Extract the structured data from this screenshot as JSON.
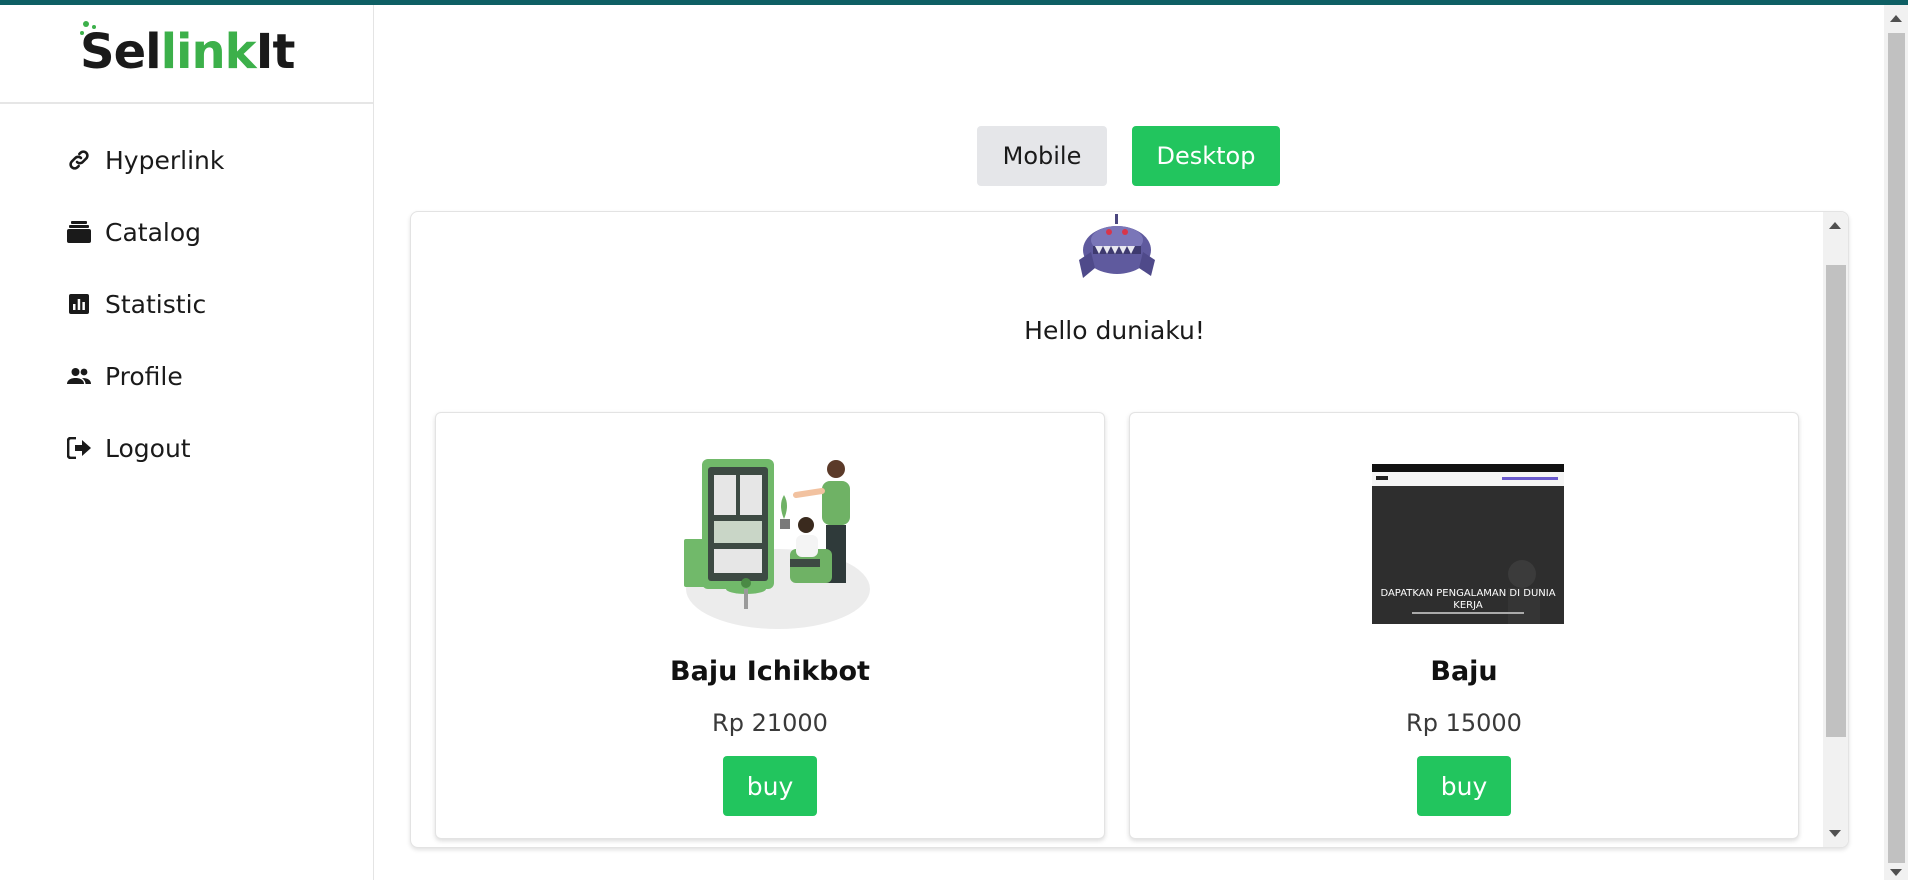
{
  "brand": {
    "logo_part1": "Sel",
    "logo_part2": "link",
    "logo_part3": "It",
    "green": "#3cb04a",
    "dark": "#1a1a1a"
  },
  "sidebar": {
    "items": [
      {
        "label": "Hyperlink",
        "icon": "link-icon"
      },
      {
        "label": "Catalog",
        "icon": "catalog-icon"
      },
      {
        "label": "Statistic",
        "icon": "chart-icon"
      },
      {
        "label": "Profile",
        "icon": "users-icon"
      },
      {
        "label": "Logout",
        "icon": "logout-icon"
      }
    ]
  },
  "view_toggle": {
    "mobile_label": "Mobile",
    "desktop_label": "Desktop",
    "selected": "Desktop",
    "accent": "#22c55e"
  },
  "preview": {
    "greeting": "Hello duniaku!",
    "products": [
      {
        "name": "Baju Ichikbot",
        "price": "Rp 21000",
        "button": "buy",
        "image": "illustration-people-dashboard"
      },
      {
        "name": "Baju",
        "price": "Rp 15000",
        "button": "buy",
        "image": "website-screenshot",
        "image_text": "DAPATKAN PENGALAMAN DI DUNIA KERJA"
      }
    ]
  }
}
